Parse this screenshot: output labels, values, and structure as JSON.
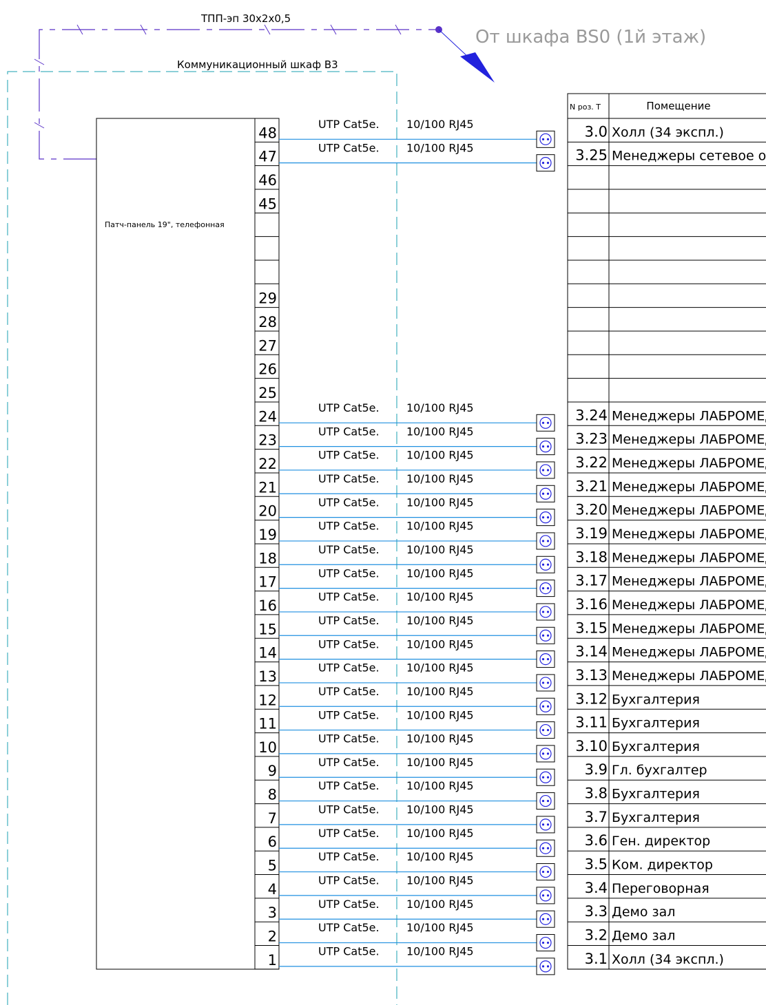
{
  "header": {
    "trunk_cable_label": "ТПП-эп 30x2x0,5",
    "source_label": "От шкафа BS0 (1й этаж)",
    "cabinet_label": "Коммуникационный шкаф B3"
  },
  "patch_panel": {
    "label": "Патч-панель 19\", телефонная"
  },
  "table": {
    "col1_header": "N роз. Т",
    "col2_header": "Помещение"
  },
  "colors": {
    "cable": "#1f8fe0",
    "trunk": "#5a32c8",
    "arrow": "#2222dd",
    "socket": "#2222dd",
    "frame": "#000000"
  },
  "ports": [
    {
      "port": "48",
      "cable": "UTP Cat5e.",
      "spec": "10/100 RJ45",
      "socket": "3.0",
      "room": "Холл (34 экспл.)"
    },
    {
      "port": "47",
      "cable": "UTP Cat5e.",
      "spec": "10/100 RJ45",
      "socket": "3.25",
      "room": "Менеджеры сетевое обор"
    },
    {
      "port": "46",
      "cable": "",
      "spec": "",
      "socket": "",
      "room": ""
    },
    {
      "port": "45",
      "cable": "",
      "spec": "",
      "socket": "",
      "room": ""
    },
    {
      "port": "",
      "cable": "",
      "spec": "",
      "socket": "",
      "room": ""
    },
    {
      "port": "",
      "cable": "",
      "spec": "",
      "socket": "",
      "room": ""
    },
    {
      "port": "",
      "cable": "",
      "spec": "",
      "socket": "",
      "room": ""
    },
    {
      "port": "29",
      "cable": "",
      "spec": "",
      "socket": "",
      "room": ""
    },
    {
      "port": "28",
      "cable": "",
      "spec": "",
      "socket": "",
      "room": ""
    },
    {
      "port": "27",
      "cable": "",
      "spec": "",
      "socket": "",
      "room": ""
    },
    {
      "port": "26",
      "cable": "",
      "spec": "",
      "socket": "",
      "room": ""
    },
    {
      "port": "25",
      "cable": "",
      "spec": "",
      "socket": "",
      "room": ""
    },
    {
      "port": "24",
      "cable": "UTP Cat5e.",
      "spec": "10/100 RJ45",
      "socket": "3.24",
      "room": "Менеджеры ЛАБРОМЕД"
    },
    {
      "port": "23",
      "cable": "UTP Cat5e.",
      "spec": "10/100 RJ45",
      "socket": "3.23",
      "room": "Менеджеры ЛАБРОМЕД"
    },
    {
      "port": "22",
      "cable": "UTP Cat5e.",
      "spec": "10/100 RJ45",
      "socket": "3.22",
      "room": "Менеджеры ЛАБРОМЕД"
    },
    {
      "port": "21",
      "cable": "UTP Cat5e.",
      "spec": "10/100 RJ45",
      "socket": "3.21",
      "room": "Менеджеры ЛАБРОМЕД"
    },
    {
      "port": "20",
      "cable": "UTP Cat5e.",
      "spec": "10/100 RJ45",
      "socket": "3.20",
      "room": "Менеджеры ЛАБРОМЕД"
    },
    {
      "port": "19",
      "cable": "UTP Cat5e.",
      "spec": "10/100 RJ45",
      "socket": "3.19",
      "room": "Менеджеры ЛАБРОМЕД"
    },
    {
      "port": "18",
      "cable": "UTP Cat5e.",
      "spec": "10/100 RJ45",
      "socket": "3.18",
      "room": "Менеджеры ЛАБРОМЕД"
    },
    {
      "port": "17",
      "cable": "UTP Cat5e.",
      "spec": "10/100 RJ45",
      "socket": "3.17",
      "room": "Менеджеры ЛАБРОМЕД"
    },
    {
      "port": "16",
      "cable": "UTP Cat5e.",
      "spec": "10/100 RJ45",
      "socket": "3.16",
      "room": "Менеджеры ЛАБРОМЕД"
    },
    {
      "port": "15",
      "cable": "UTP Cat5e.",
      "spec": "10/100 RJ45",
      "socket": "3.15",
      "room": "Менеджеры ЛАБРОМЕД"
    },
    {
      "port": "14",
      "cable": "UTP Cat5e.",
      "spec": "10/100 RJ45",
      "socket": "3.14",
      "room": "Менеджеры ЛАБРОМЕД"
    },
    {
      "port": "13",
      "cable": "UTP Cat5e.",
      "spec": "10/100 RJ45",
      "socket": "3.13",
      "room": "Менеджеры ЛАБРОМЕД"
    },
    {
      "port": "12",
      "cable": "UTP Cat5e.",
      "spec": "10/100 RJ45",
      "socket": "3.12",
      "room": "Бухгалтерия"
    },
    {
      "port": "11",
      "cable": "UTP Cat5e.",
      "spec": "10/100 RJ45",
      "socket": "3.11",
      "room": "Бухгалтерия"
    },
    {
      "port": "10",
      "cable": "UTP Cat5e.",
      "spec": "10/100 RJ45",
      "socket": "3.10",
      "room": "Бухгалтерия"
    },
    {
      "port": "9",
      "cable": "UTP Cat5e.",
      "spec": "10/100 RJ45",
      "socket": "3.9",
      "room": "Гл. бухгалтер"
    },
    {
      "port": "8",
      "cable": "UTP Cat5e.",
      "spec": "10/100 RJ45",
      "socket": "3.8",
      "room": "Бухгалтерия"
    },
    {
      "port": "7",
      "cable": "UTP Cat5e.",
      "spec": "10/100 RJ45",
      "socket": "3.7",
      "room": "Бухгалтерия"
    },
    {
      "port": "6",
      "cable": "UTP Cat5e.",
      "spec": "10/100 RJ45",
      "socket": "3.6",
      "room": "Ген. директор"
    },
    {
      "port": "5",
      "cable": "UTP Cat5e.",
      "spec": "10/100 RJ45",
      "socket": "3.5",
      "room": "Ком. директор"
    },
    {
      "port": "4",
      "cable": "UTP Cat5e.",
      "spec": "10/100 RJ45",
      "socket": "3.4",
      "room": "Переговорная"
    },
    {
      "port": "3",
      "cable": "UTP Cat5e.",
      "spec": "10/100 RJ45",
      "socket": "3.3",
      "room": "Демо зал"
    },
    {
      "port": "2",
      "cable": "UTP Cat5e.",
      "spec": "10/100 RJ45",
      "socket": "3.2",
      "room": "Демо зал"
    },
    {
      "port": "1",
      "cable": "UTP Cat5e.",
      "spec": "10/100 RJ45",
      "socket": "3.1",
      "room": "Холл (34 экспл.)"
    }
  ]
}
